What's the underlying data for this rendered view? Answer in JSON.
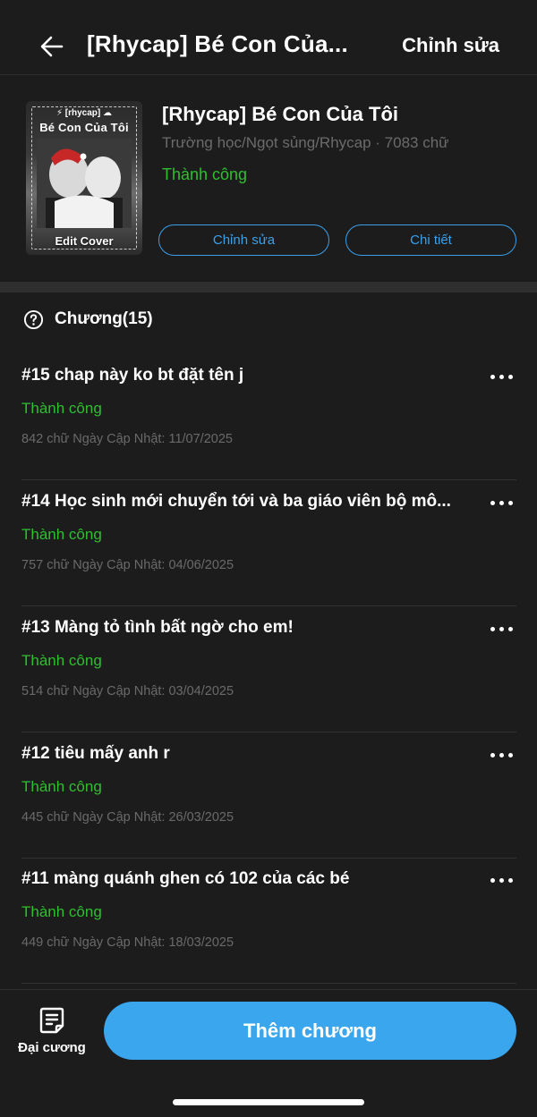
{
  "header": {
    "title": "[Rhycap] Bé Con Của...",
    "edit_label": "Chỉnh sửa"
  },
  "story": {
    "cover": {
      "tag": "⚡ [rhycap] ☁",
      "name": "Bé Con Của Tôi",
      "edit_label": "Edit Cover"
    },
    "title": "[Rhycap] Bé Con Của Tôi",
    "meta": "Trường học/Ngọt sủng/Rhycap · 7083 chữ",
    "status": "Thành công",
    "edit_button": "Chỉnh sửa",
    "detail_button": "Chi tiết"
  },
  "chapters_header": "Chương(15)",
  "chapters": [
    {
      "title": "#15 chap này ko bt đặt tên j",
      "status": "Thành công",
      "meta": "842 chữ Ngày Cập Nhật: 11/07/2025"
    },
    {
      "title": "#14 Học sinh mới chuyển tới và ba giáo viên bộ mô...",
      "status": "Thành công",
      "meta": "757 chữ Ngày Cập Nhật: 04/06/2025"
    },
    {
      "title": "#13 Màng tỏ tình bất ngờ cho em!",
      "status": "Thành công",
      "meta": "514 chữ Ngày Cập Nhật: 03/04/2025"
    },
    {
      "title": "#12 tiêu mấy anh r",
      "status": "Thành công",
      "meta": "445 chữ Ngày Cập Nhật: 26/03/2025"
    },
    {
      "title": "#11 màng quánh ghen có 102 của các bé",
      "status": "Thành công",
      "meta": "449 chữ Ngày Cập Nhật: 18/03/2025"
    }
  ],
  "bottom": {
    "outline_label": "Đại cương",
    "add_chapter_label": "Thêm chương"
  },
  "colors": {
    "background": "#1c1c1c",
    "accent": "#3aa6ee",
    "success": "#2fbf2f",
    "muted": "#6b6b6b"
  }
}
